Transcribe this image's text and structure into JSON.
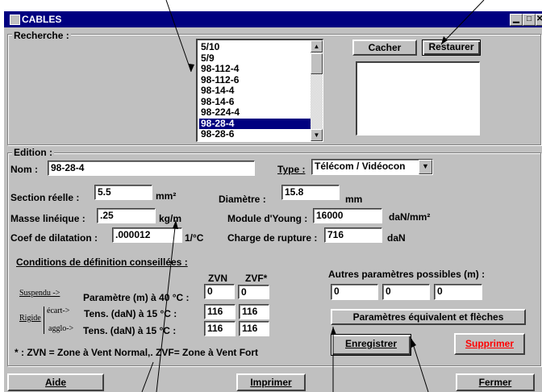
{
  "window": {
    "title": "CABLES"
  },
  "search": {
    "group_label": "Recherche :",
    "list_items": [
      "5/10",
      "5/9",
      "98-112-4",
      "98-112-6",
      "98-14-4",
      "98-14-6",
      "98-224-4",
      "98-28-4",
      "98-28-6"
    ],
    "selected_item": "98-28-4",
    "hide_label": "Cacher",
    "restore_label": "Restaurer"
  },
  "edition": {
    "group_label": "Edition :",
    "name_label": "Nom :",
    "name_value": "98-28-4",
    "type_label": "Type :",
    "type_value": "Télécom / Vidéocon",
    "section_label": "Section réelle :",
    "section_value": "5.5",
    "section_unit": "mm²",
    "diameter_label": "Diamètre :",
    "diameter_value": "15.8",
    "diameter_unit": "mm",
    "mass_label": "Masse linéique :",
    "mass_value": ".25",
    "mass_unit": "kg/m",
    "young_label": "Module d'Young :",
    "young_value": "16000",
    "young_unit": "daN/mm²",
    "dilatation_label": "Coef de dilatation :",
    "dilatation_value": ".000012",
    "dilatation_unit": "1/°C",
    "rupture_label": "Charge de rupture :",
    "rupture_value": "716",
    "rupture_unit": "daN"
  },
  "conditions": {
    "title": "Conditions de définition conseillées :",
    "zvn_header": "ZVN",
    "zvf_header": "ZVF*",
    "suspended_label": "Suspendu ->",
    "param_label": "Paramètre (m) à 40 °C :",
    "param_zvn": "0",
    "param_zvf": "0",
    "rigid_label": "Rigide",
    "gap_label": "écart->",
    "tens_gap_label": "Tens. (daN) à 15 °C :",
    "tens_gap_zvn": "116",
    "tens_gap_zvf": "116",
    "agglo_label": "agglo->",
    "tens_agglo_label": "Tens. (daN) à 15 °C :",
    "tens_agglo_zvn": "116",
    "tens_agglo_zvf": "116",
    "footnote": "* : ZVN = Zone à Vent Normal,. ZVF= Zone à Vent Fort"
  },
  "other_params": {
    "title": "Autres paramètres possibles (m) :",
    "values": [
      "0",
      "0",
      "0"
    ],
    "equiv_button": "Paramètres équivalent et flèches"
  },
  "actions": {
    "save": "Enregistrer",
    "delete": "Supprimer",
    "help": "Aide",
    "print": "Imprimer",
    "close": "Fermer"
  },
  "colors": {
    "titlebar": "#000080",
    "face": "#c0c0c0",
    "delete_text": "#ff0000"
  }
}
